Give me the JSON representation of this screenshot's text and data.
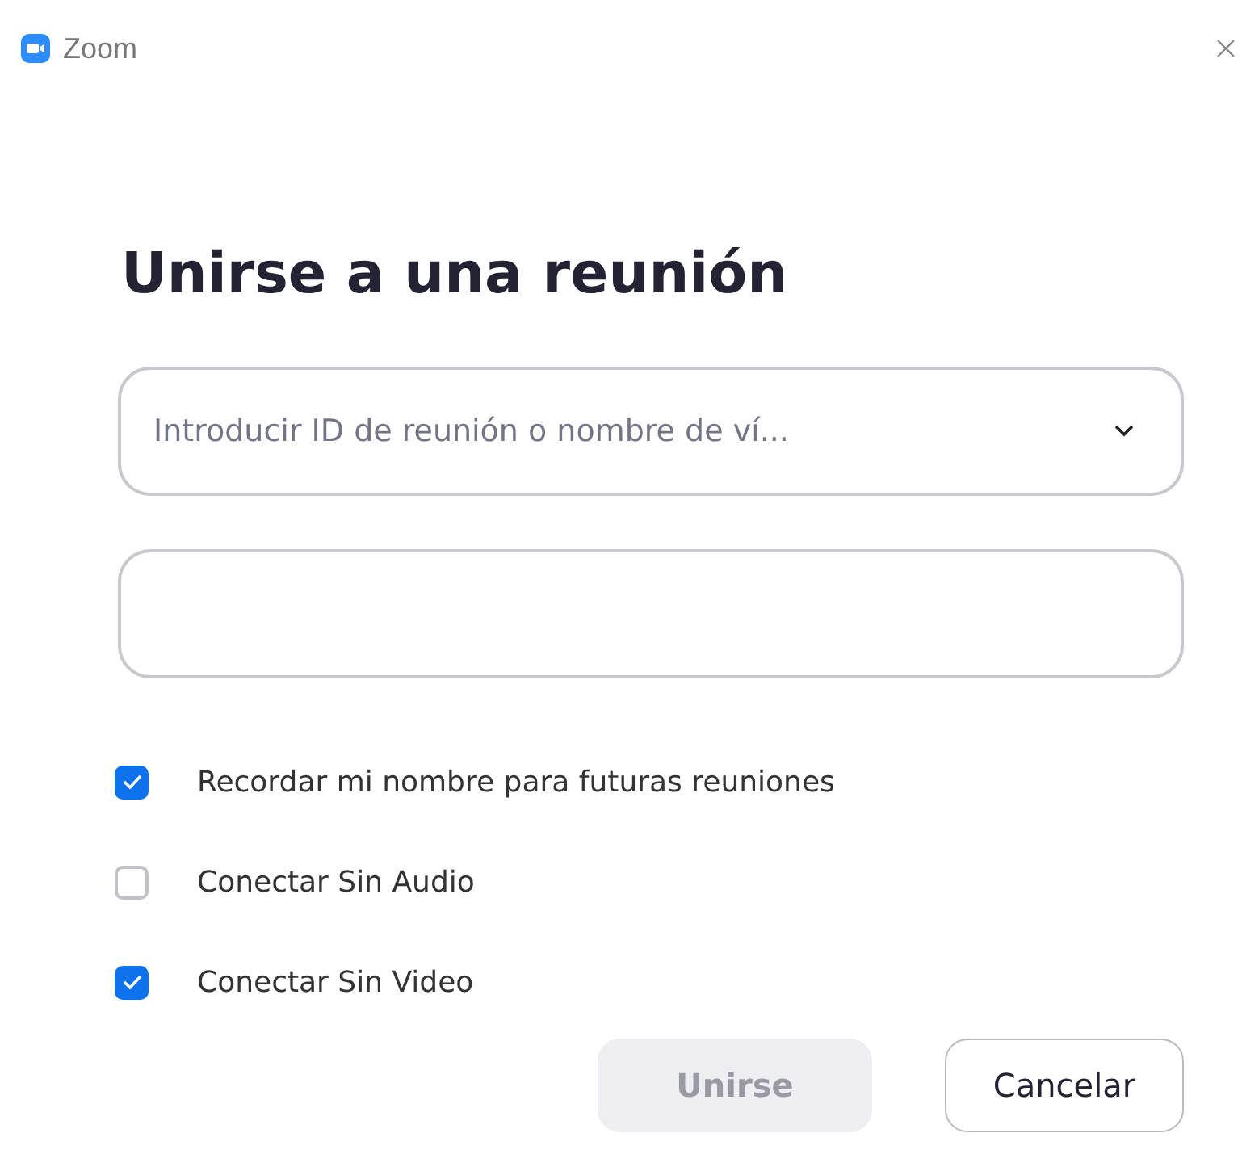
{
  "window": {
    "title": "Zoom"
  },
  "heading": "Unirse a una reunión",
  "meeting_field": {
    "placeholder": "Introducir ID de reunión o nombre de ví..."
  },
  "options": [
    {
      "label": "Recordar mi nombre para futuras reuniones",
      "checked": true
    },
    {
      "label": "Conectar Sin Audio",
      "checked": false
    },
    {
      "label": "Conectar Sin Video",
      "checked": true
    }
  ],
  "buttons": [
    {
      "label": "Unirse",
      "disabled": true
    },
    {
      "label": "Cancelar",
      "disabled": false
    }
  ]
}
